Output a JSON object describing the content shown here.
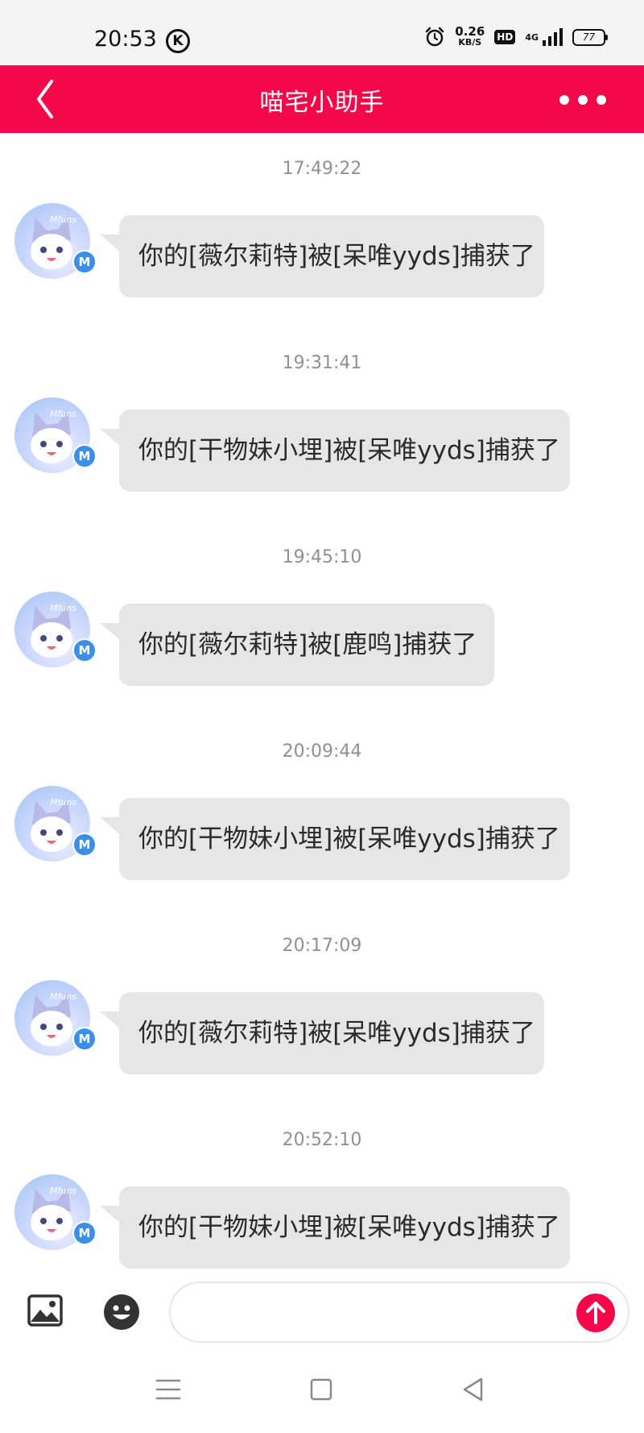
{
  "status_bar": {
    "time": "20:53",
    "k_badge": "K",
    "net_speed_value": "0.26",
    "net_speed_unit": "KB/S",
    "hd_label": "HD",
    "signal_label": "4G",
    "battery_level": "77",
    "icons": [
      "k-app-icon",
      "alarm-icon",
      "signal-icon",
      "battery-icon"
    ]
  },
  "header": {
    "title": "喵宅小助手",
    "back_icon": "chevron-left-icon",
    "more_icon": "more-dots-icon"
  },
  "messages": [
    {
      "time": "17:49:22",
      "text": "你的[薇尔莉特]被[呆唯yyds]捕获了",
      "avatar_text": "Mfuns",
      "badge": "M"
    },
    {
      "time": "19:31:41",
      "text": "你的[干物妹小埋]被[呆唯yyds]捕获了",
      "avatar_text": "Mfuns",
      "badge": "M"
    },
    {
      "time": "19:45:10",
      "text": "你的[薇尔莉特]被[鹿鸣]捕获了",
      "avatar_text": "Mfuns",
      "badge": "M"
    },
    {
      "time": "20:09:44",
      "text": "你的[干物妹小埋]被[呆唯yyds]捕获了",
      "avatar_text": "Mfuns",
      "badge": "M"
    },
    {
      "time": "20:17:09",
      "text": "你的[薇尔莉特]被[呆唯yyds]捕获了",
      "avatar_text": "Mfuns",
      "badge": "M"
    },
    {
      "time": "20:52:10",
      "text": "你的[干物妹小埋]被[呆唯yyds]捕获了",
      "avatar_text": "Mfuns",
      "badge": "M"
    }
  ],
  "input_bar": {
    "value": "",
    "placeholder": "",
    "icons": [
      "image-icon",
      "emoji-icon",
      "send-arrow-icon"
    ]
  },
  "nav_bar": {
    "icons": [
      "menu-icon",
      "home-square-icon",
      "back-triangle-icon"
    ]
  },
  "colors": {
    "accent": "#f4084a",
    "bubble": "#e6e6e6",
    "timestamp": "#909090",
    "badge": "#3b8fe8"
  }
}
